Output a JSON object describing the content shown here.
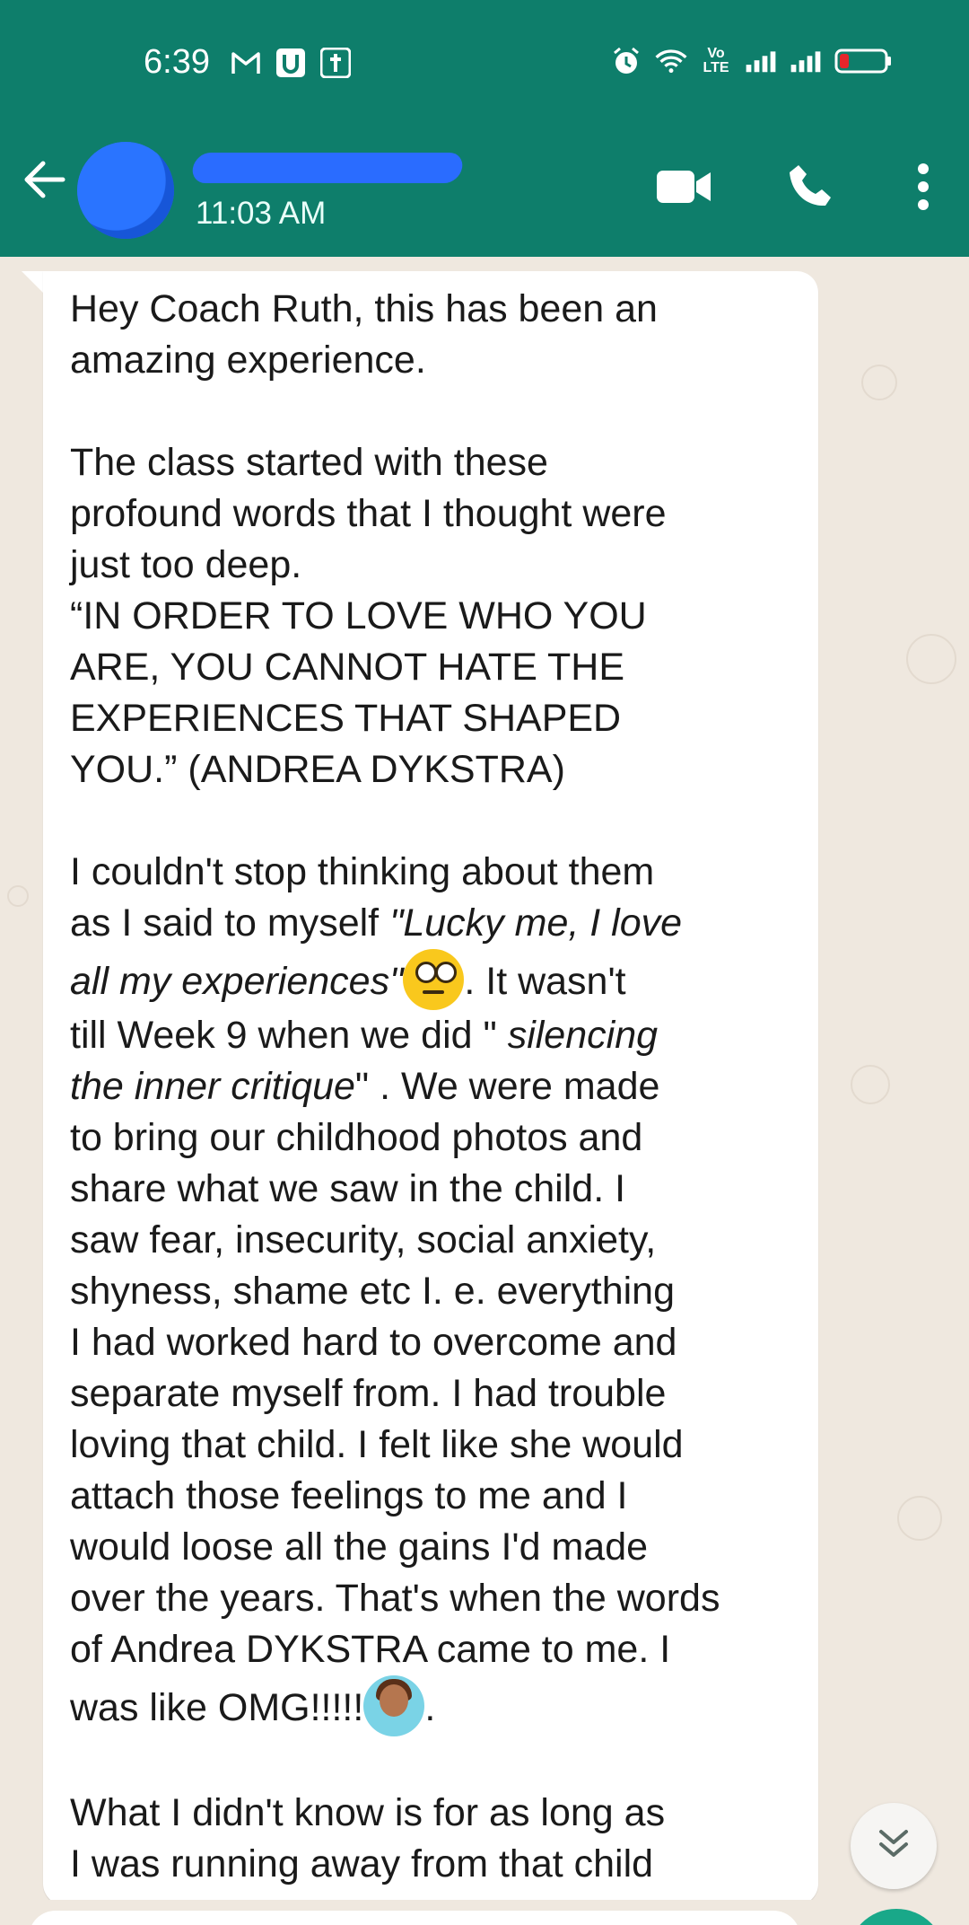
{
  "status_bar": {
    "time": "6:39",
    "left_icons": [
      "gmail-icon",
      "u-app-icon",
      "bible-app-icon"
    ],
    "volte": "Vo LTE",
    "right_icons": [
      "alarm-icon",
      "wifi-icon",
      "volte-icon",
      "signal-1-icon",
      "signal-2-icon",
      "battery-low-icon"
    ],
    "battery_color": "#e5252a"
  },
  "header": {
    "last_seen": "11:03 AM",
    "actions": [
      "video-call-icon",
      "voice-call-icon",
      "more-options-icon"
    ]
  },
  "colors": {
    "header_bg": "#0e7e6b",
    "chat_bg": "#efe8df",
    "bubble_bg": "#ffffff"
  },
  "message": {
    "p1": "Hey Coach Ruth, this has been an\namazing experience.",
    "p2": "The class started with these\nprofound words that I thought were\njust too deep.\n“IN ORDER TO LOVE WHO YOU\nARE, YOU CANNOT HATE THE\nEXPERIENCES THAT SHAPED\nYOU.” (ANDREA DYKSTRA)",
    "p3_a": "I couldn't stop thinking about them\nas I said to myself ",
    "p3_quote": "\"Lucky me, I love\nall my experiences\"",
    "p3_b": ". It wasn't\ntill Week 9 when we did \" ",
    "p3_italic": "silencing\nthe inner critique",
    "p3_c": "\" . We were made\nto bring our childhood photos and\nshare what we saw in the child. I\nsaw fear, insecurity, social anxiety,\nshyness, shame etc I. e. everything\nI had worked hard to overcome and\nseparate myself from. I had trouble\nloving that child. I felt like she would\nattach those feelings to me and I\nwould loose all the gains I'd made\nover the years. That's when the words\nof Andrea DYKSTRA came to me. I\nwas like OMG!!!!!",
    "p3_end": ".",
    "p4": "What I didn't know is for as long as\nI was running away from that child"
  }
}
